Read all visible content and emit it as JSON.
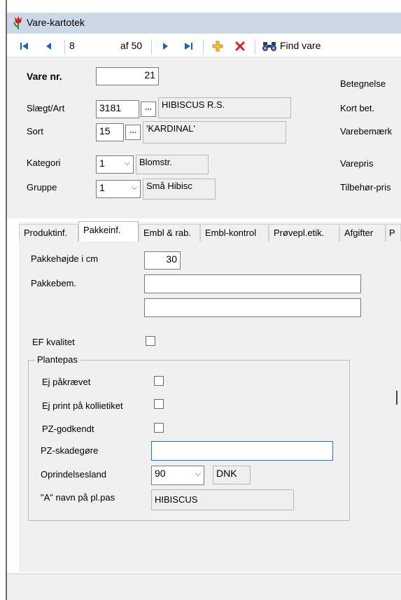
{
  "window": {
    "title": "Vare-kartotek"
  },
  "toolbar": {
    "first_icon": "first-record-icon",
    "prev_icon": "previous-record-icon",
    "record_number": "8",
    "record_of": "af 50",
    "next_icon": "next-record-icon",
    "last_icon": "last-record-icon",
    "add_icon": "add-icon",
    "delete_icon": "delete-icon",
    "find_icon": "binoculars-icon",
    "find_label": "Find vare"
  },
  "header": {
    "vare_nr_label": "Vare nr.",
    "vare_nr_value": "21",
    "slaegt_label": "Slægt/Art",
    "slaegt_code": "3181",
    "slaegt_name": "HIBISCUS R.S.",
    "sort_label": "Sort",
    "sort_code": "15",
    "sort_name": "'KARDINAL'",
    "kategori_label": "Kategori",
    "kategori_value": "1",
    "kategori_name": "Blomstr.",
    "gruppe_label": "Gruppe",
    "gruppe_value": "1",
    "gruppe_name": "Små Hibisc",
    "right_labels": {
      "betegnelse": "Betegnelse",
      "kort_bet": "Kort bet.",
      "varebemaerk": "Varebemærk",
      "varepris": "Varepris",
      "tilbehor": "Tilbehør-pris"
    },
    "dots_label": "..."
  },
  "tabs": [
    {
      "label": "Produktinf."
    },
    {
      "label": "Pakkeinf."
    },
    {
      "label": "Embl & rab."
    },
    {
      "label": "Embl-kontrol"
    },
    {
      "label": "Prøvepl.etik."
    },
    {
      "label": "Afgifter"
    },
    {
      "label": "P"
    }
  ],
  "pakke": {
    "hojde_label": "Pakkehøjde i cm",
    "hojde_value": "30",
    "bem_label": "Pakkebem.",
    "bem_line1": "",
    "bem_line2": "",
    "ef_label": "EF kvalitet",
    "plantepas": {
      "title": "Plantepas",
      "ej_paakraevet": "Ej påkrævet",
      "ej_print": "Ej print på kollietiket",
      "pz_godkendt": "PZ-godkendt",
      "pz_skadegore_label": "PZ-skadegøre",
      "pz_skadegore_value": "",
      "oprindelse_label": "Oprindelsesland",
      "oprindelse_value": "90",
      "oprindelse_code": "DNK",
      "a_navn_label": "\"A\" navn på pl.pas",
      "a_navn_value": "HIBISCUS"
    }
  },
  "colors": {
    "accent": "#1a5bd6",
    "delete": "#e02020",
    "add": "#e0a020",
    "titlebar": "#cdd8e6",
    "panel": "#f0f0f0"
  }
}
